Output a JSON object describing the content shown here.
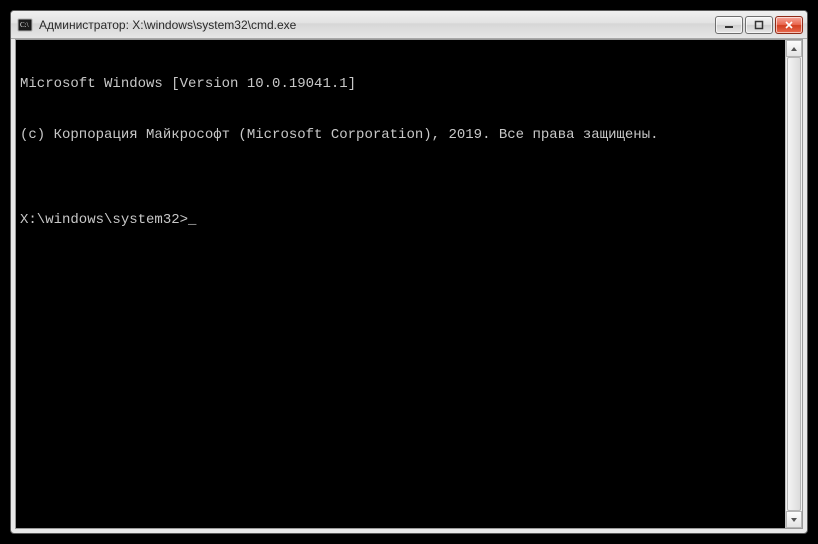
{
  "window": {
    "title": "Администратор: X:\\windows\\system32\\cmd.exe"
  },
  "terminal": {
    "line1": "Microsoft Windows [Version 10.0.19041.1]",
    "line2": "(c) Корпорация Майкрософт (Microsoft Corporation), 2019. Все права защищены.",
    "blank": "",
    "prompt": "X:\\windows\\system32>"
  }
}
